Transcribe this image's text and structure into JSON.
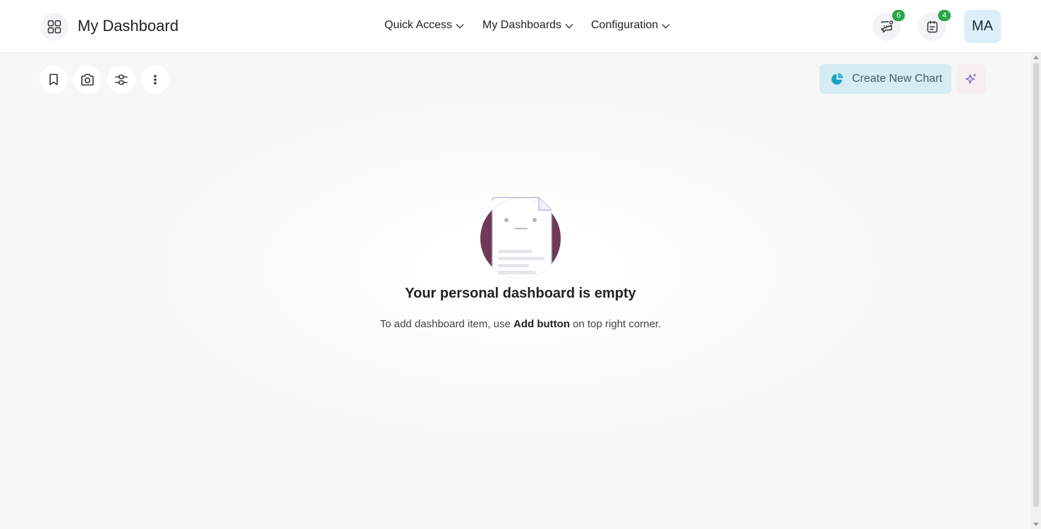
{
  "header": {
    "title": "My Dashboard",
    "menu": [
      {
        "label": "Quick Access"
      },
      {
        "label": "My Dashboards"
      },
      {
        "label": "Configuration"
      }
    ],
    "messages_count": "6",
    "activities_count": "4",
    "user_initials": "MA"
  },
  "toolbar": {
    "create_label": "Create New Chart",
    "icons": [
      "bookmark-icon",
      "camera-icon",
      "filter-sliders-icon",
      "more-vertical-icon"
    ]
  },
  "empty_state": {
    "title": "Your personal dashboard is empty",
    "text_before": "To add dashboard item, use ",
    "text_bold": "Add button",
    "text_after": " on top right corner."
  },
  "colors": {
    "accent_green": "#28a745",
    "create_button_bg": "#d4ecf2",
    "chart_icon": "#1aa3c4",
    "illustration_circle": "#6e3a55"
  }
}
